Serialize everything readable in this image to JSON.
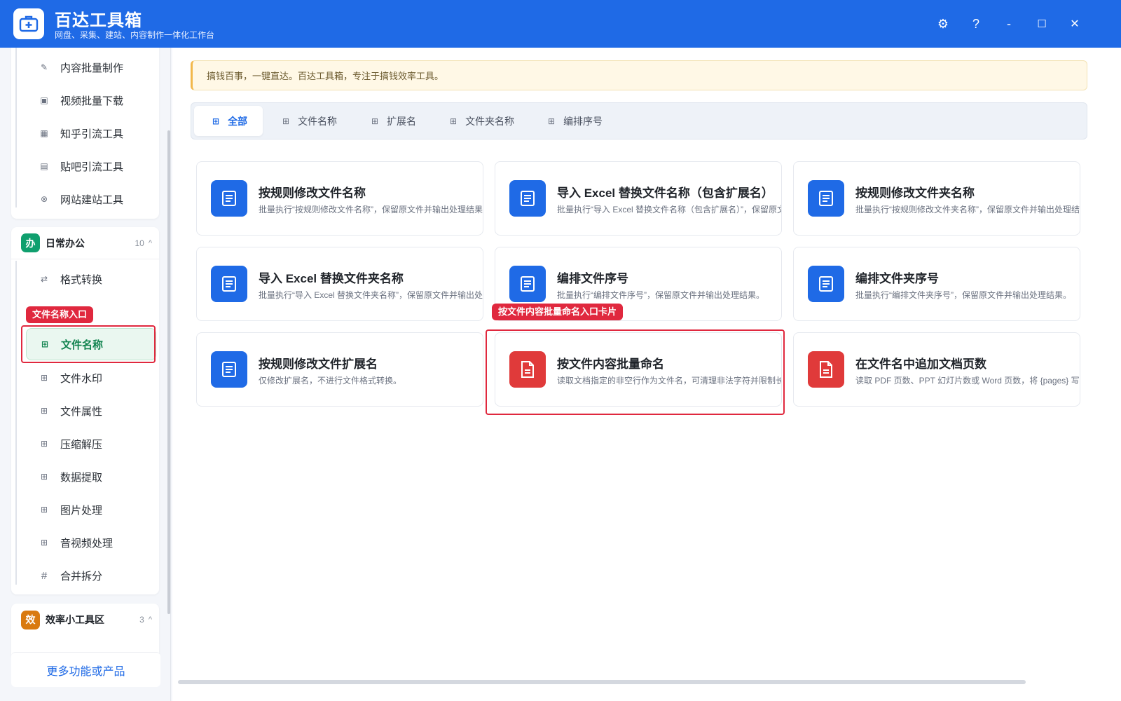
{
  "app": {
    "title": "百达工具箱",
    "subtitle": "网盘、采集、建站、内容制作一体化工作台"
  },
  "window": {
    "settings": "⚙",
    "help": "?",
    "minimize": "-",
    "maximize": "☐",
    "close": "✕"
  },
  "sidebar": {
    "top_items": [
      {
        "label": "内容批量制作",
        "icon": "pen-icon",
        "glyph": "✎"
      },
      {
        "label": "视频批量下载",
        "icon": "video-icon",
        "glyph": "▣"
      },
      {
        "label": "知乎引流工具",
        "icon": "zhihu-icon",
        "glyph": "▦"
      },
      {
        "label": "贴吧引流工具",
        "icon": "forum-icon",
        "glyph": "▤"
      },
      {
        "label": "网站建站工具",
        "icon": "globe-icon",
        "glyph": "⊗"
      }
    ],
    "office_group": {
      "badge": "办",
      "title": "日常办公",
      "count": "10",
      "chevron": "^",
      "items": [
        {
          "label": "格式转换",
          "icon": "swap-icon",
          "glyph": "⇄"
        },
        {
          "label": "文件名称",
          "icon": "grid-icon",
          "glyph": "⊞"
        },
        {
          "label": "文件水印",
          "icon": "grid-icon",
          "glyph": "⊞"
        },
        {
          "label": "文件属性",
          "icon": "grid-icon",
          "glyph": "⊞"
        },
        {
          "label": "压缩解压",
          "icon": "grid-icon",
          "glyph": "⊞"
        },
        {
          "label": "数据提取",
          "icon": "grid-icon",
          "glyph": "⊞"
        },
        {
          "label": "图片处理",
          "icon": "grid-icon",
          "glyph": "⊞"
        },
        {
          "label": "音视频处理",
          "icon": "grid-icon",
          "glyph": "⊞"
        },
        {
          "label": "合并拆分",
          "icon": "hash-icon",
          "glyph": "#"
        }
      ]
    },
    "efficiency_group": {
      "badge": "效",
      "title": "效率小工具区",
      "count": "3",
      "chevron": "^"
    },
    "more_link": "更多功能或产品"
  },
  "callouts": {
    "sidebar": "文件名称入口",
    "card": "按文件内容批量命名入口卡片"
  },
  "notice": "搞钱百事，一键直达。百达工具箱，专注于搞钱效率工具。",
  "tabs": [
    {
      "label": "全部",
      "active": true
    },
    {
      "label": "文件名称",
      "active": false
    },
    {
      "label": "扩展名",
      "active": false
    },
    {
      "label": "文件夹名称",
      "active": false
    },
    {
      "label": "编排序号",
      "active": false
    }
  ],
  "cards": [
    {
      "title": "按规则修改文件名称",
      "desc": "批量执行“按规则修改文件名称”，保留原文件并输出处理结果。",
      "color": "#1f6ae6"
    },
    {
      "title": "导入 Excel 替换文件名称（包含扩展名）",
      "desc": "批量执行“导入 Excel 替换文件名称（包含扩展名）”，保留原文件并输出处理结果。",
      "color": "#1f6ae6"
    },
    {
      "title": "按规则修改文件夹名称",
      "desc": "批量执行“按规则修改文件夹名称”，保留原文件并输出处理结果。",
      "color": "#1f6ae6"
    },
    {
      "title": "导入 Excel 替换文件夹名称",
      "desc": "批量执行“导入 Excel 替换文件夹名称”，保留原文件并输出处理结果。",
      "color": "#1f6ae6"
    },
    {
      "title": "编排文件序号",
      "desc": "批量执行“编排文件序号”，保留原文件并输出处理结果。",
      "color": "#1f6ae6"
    },
    {
      "title": "编排文件夹序号",
      "desc": "批量执行“编排文件夹序号”，保留原文件并输出处理结果。",
      "color": "#1f6ae6"
    },
    {
      "title": "按规则修改文件扩展名",
      "desc": "仅修改扩展名，不进行文件格式转换。",
      "color": "#1f6ae6"
    },
    {
      "title": "按文件内容批量命名",
      "desc": "读取文档指定的非空行作为文件名，可清理非法字符并限制长度；",
      "color": "#e03a3a"
    },
    {
      "title": "在文件名中追加文档页数",
      "desc": "读取 PDF 页数、PPT 幻灯片数或 Word 页数，将 {pages} 写入命名",
      "color": "#e03a3a"
    }
  ],
  "colors": {
    "brand": "#1f6ae6",
    "active_green": "#11834f",
    "callout_red": "#e0283e",
    "office_badge": "#0f9f6e",
    "efficiency_badge": "#d97a10"
  }
}
